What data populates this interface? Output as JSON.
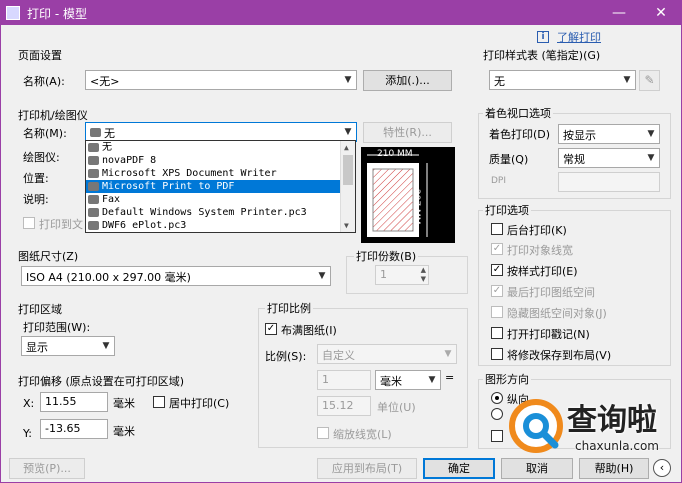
{
  "window": {
    "title": "打印 - 模型",
    "controls": {
      "minimize": "—",
      "close": "✕"
    }
  },
  "help_link": {
    "icon": "i",
    "label": "了解打印"
  },
  "page_setup": {
    "title": "页面设置",
    "name_label": "名称(A):",
    "name_value": "<无>",
    "add_button": "添加(.)..."
  },
  "printer": {
    "title": "打印机/绘图仪",
    "name_label": "名称(M):",
    "name_value": "无",
    "properties_button": "特性(R)...",
    "plotter_label": "绘图仪:",
    "location_label": "位置:",
    "description_label": "说明:",
    "print_to_file": "打印到文",
    "dropdown_items": [
      "无",
      "novaPDF 8",
      "Microsoft XPS Document Writer",
      "Microsoft Print to PDF",
      "Fax",
      "Default Windows System Printer.pc3",
      "DWF6 ePlot.pc3"
    ],
    "selected_index": 3,
    "preview": {
      "width_text": "210 MM",
      "height_text": "297 MM"
    }
  },
  "paper_size": {
    "title": "图纸尺寸(Z)",
    "value": "ISO A4 (210.00 x 297.00 毫米)"
  },
  "copies": {
    "title": "打印份数(B)",
    "value": "1"
  },
  "plot_area": {
    "title": "打印区域",
    "range_label": "打印范围(W):",
    "range_value": "显示"
  },
  "plot_offset": {
    "title": "打印偏移 (原点设置在可打印区域)",
    "x_label": "X:",
    "x_value": "11.55",
    "x_unit": "毫米",
    "center_label": "居中打印(C)",
    "y_label": "Y:",
    "y_value": "-13.65",
    "y_unit": "毫米"
  },
  "plot_scale": {
    "title": "打印比例",
    "fit_label": "布满图纸(I)",
    "scale_label": "比例(S):",
    "scale_value": "自定义",
    "value1": "1",
    "unit": "毫米",
    "equals": "=",
    "value2": "15.12",
    "unit2_label": "单位(U)",
    "lineweight_label": "缩放线宽(L)"
  },
  "plot_style": {
    "title": "打印样式表 (笔指定)(G)",
    "value": "无"
  },
  "shaded_viewport": {
    "title": "着色视口选项",
    "shade_label": "着色打印(D)",
    "shade_value": "按显示",
    "quality_label": "质量(Q)",
    "quality_value": "常规",
    "dpi_label": "DPI"
  },
  "plot_options": {
    "title": "打印选项",
    "items": [
      {
        "label": "后台打印(K)",
        "checked": false,
        "disabled": false
      },
      {
        "label": "打印对象线宽",
        "checked": true,
        "disabled": true
      },
      {
        "label": "按样式打印(E)",
        "checked": true,
        "disabled": false
      },
      {
        "label": "最后打印图纸空间",
        "checked": true,
        "disabled": true
      },
      {
        "label": "隐藏图纸空间对象(J)",
        "checked": false,
        "disabled": true
      },
      {
        "label": "打开打印戳记(N)",
        "checked": false,
        "disabled": false
      },
      {
        "label": "将修改保存到布局(V)",
        "checked": false,
        "disabled": false
      }
    ]
  },
  "orientation": {
    "title": "图形方向",
    "portrait": "纵向"
  },
  "footer": {
    "preview": "预览(P)...",
    "apply": "应用到布局(T)",
    "ok": "确定",
    "cancel": "取消",
    "help": "帮助(H)"
  },
  "watermark": {
    "text": "查询啦",
    "url": "chaxunla.com"
  },
  "colors": {
    "title_bar": "#9a3fa6",
    "selection": "#0078d7",
    "dialog_bg": "#f0f0f0"
  }
}
